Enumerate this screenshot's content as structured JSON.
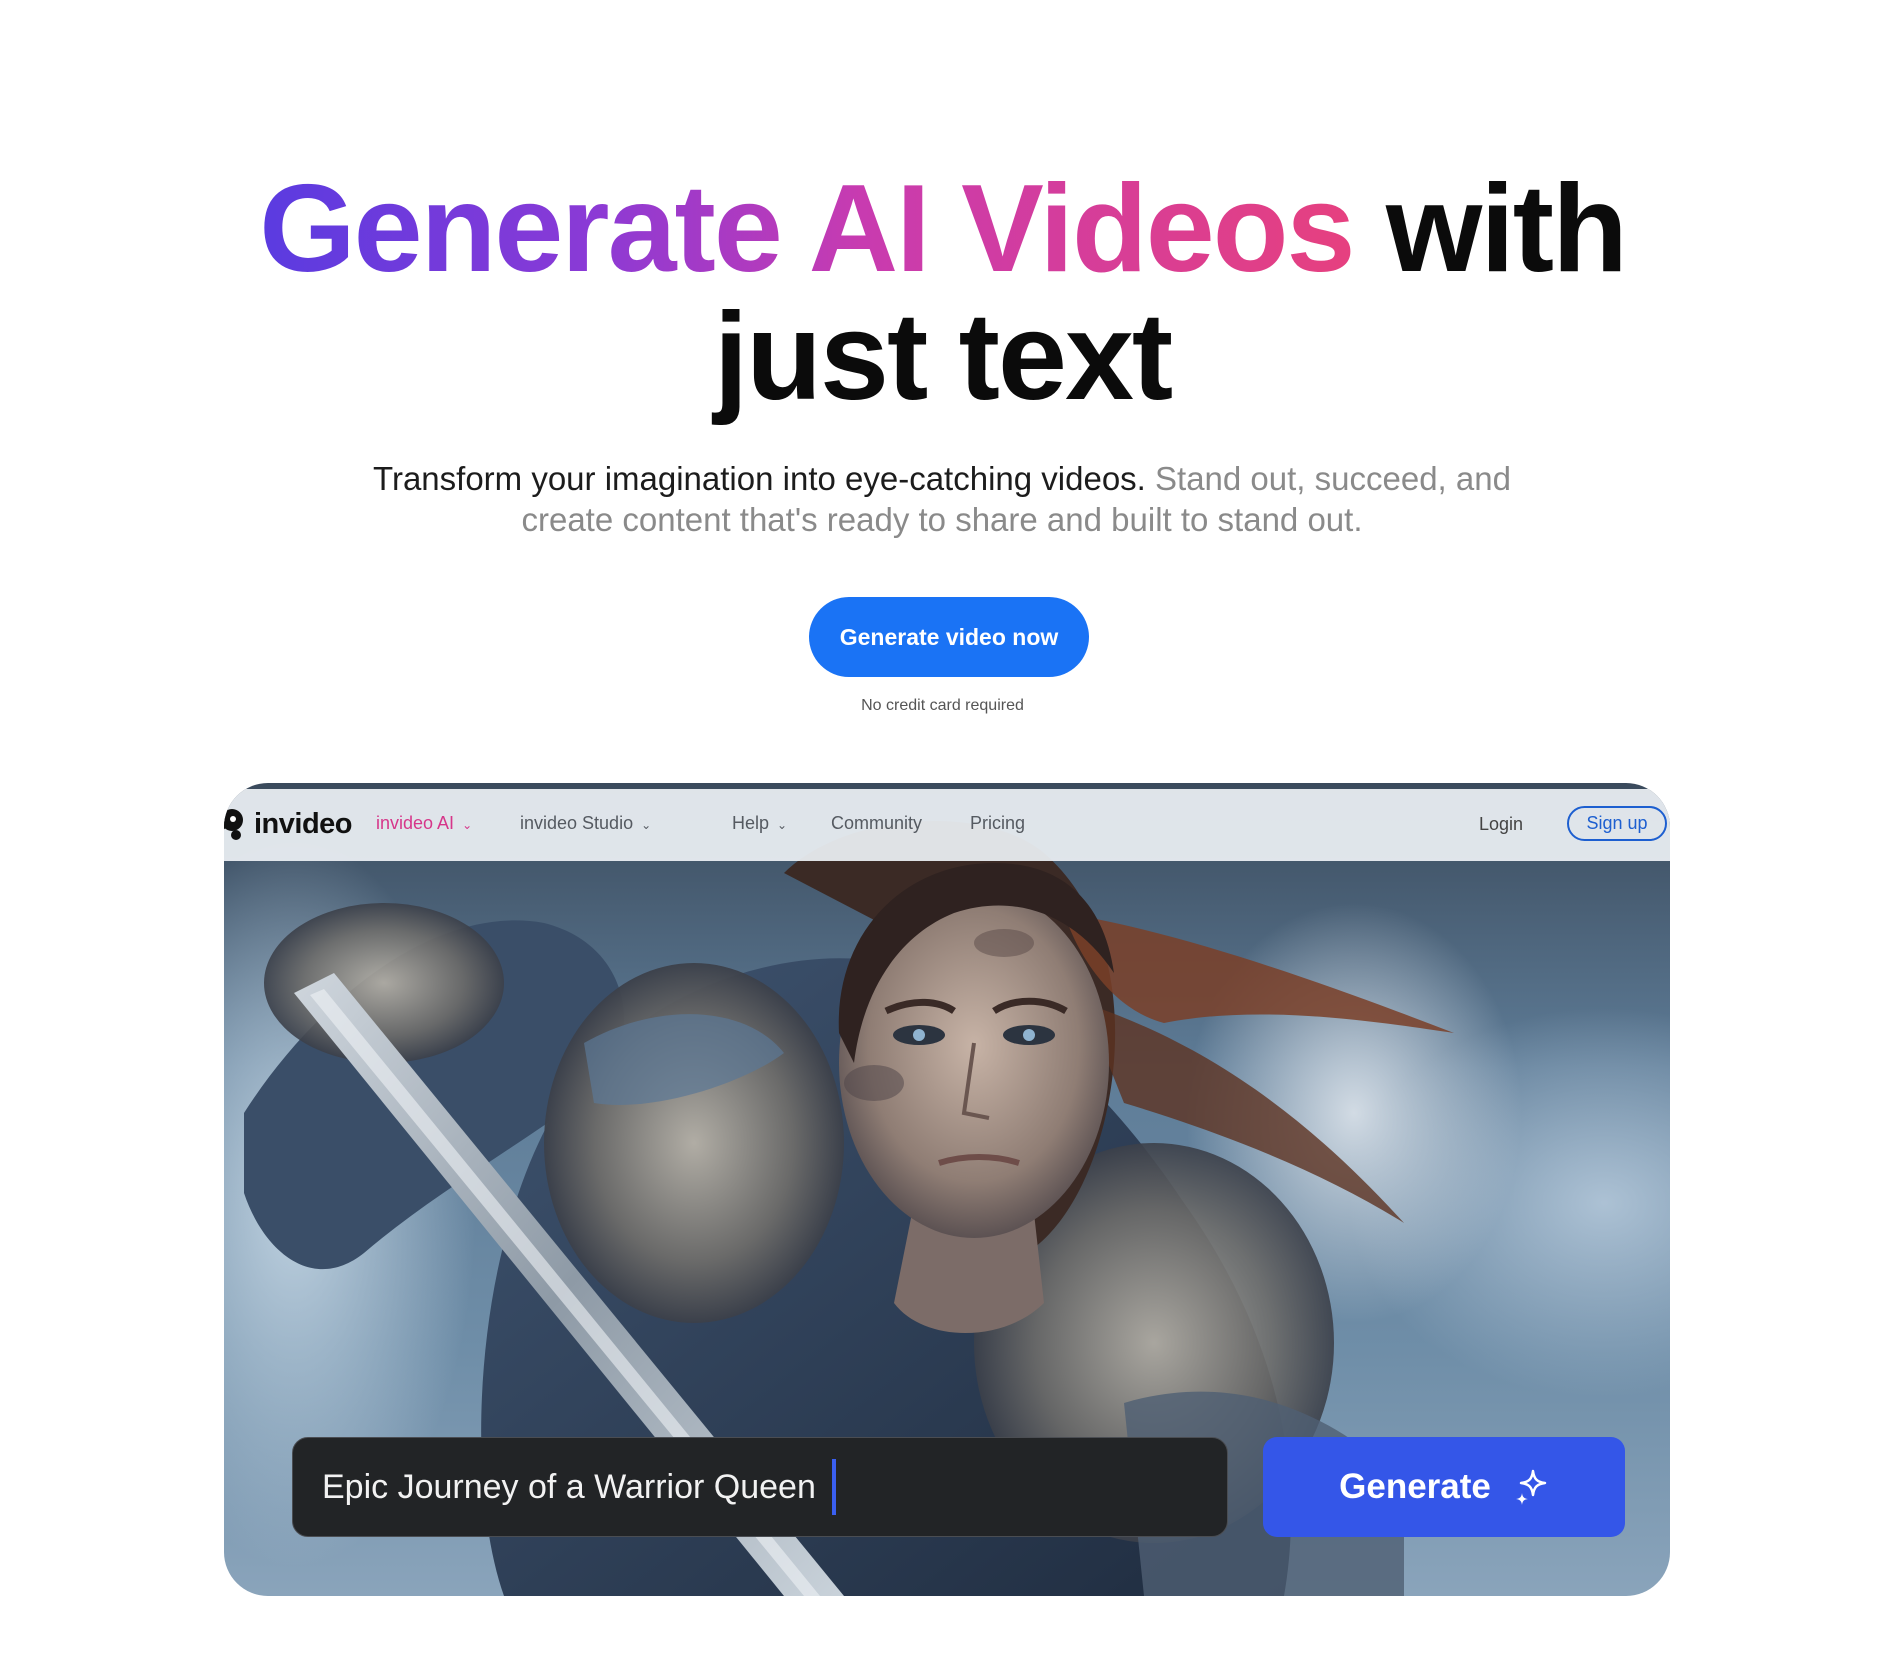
{
  "hero": {
    "title_gradient": "Generate AI Videos",
    "title_rest_line1": " with",
    "title_line2": "just text",
    "subtitle_strong": "Transform your imagination into eye-catching videos.",
    "subtitle_rest": " Stand out, succeed, and create content that's ready to share and built to stand out.",
    "cta_label": "Generate video now",
    "cta_note": "No credit card required"
  },
  "preview": {
    "nav": {
      "logo_text": "invideo",
      "items": [
        {
          "label": "invideo AI",
          "active": true,
          "dropdown": true
        },
        {
          "label": "invideo Studio",
          "active": false,
          "dropdown": true
        },
        {
          "label": "Help",
          "active": false,
          "dropdown": true
        },
        {
          "label": "Community",
          "active": false,
          "dropdown": false
        },
        {
          "label": "Pricing",
          "active": false,
          "dropdown": false
        }
      ],
      "login_label": "Login",
      "signup_label": "Sign up"
    },
    "prompt": {
      "value": "Epic Journey of a Warrior Queen"
    },
    "generate_label": "Generate",
    "icons": {
      "logo": "invideo-logo-icon",
      "dropdown": "chevron-down-icon",
      "generate": "sparkle-icon"
    }
  },
  "colors": {
    "cta": "#1a73f5",
    "generate": "#3456e8",
    "active_nav": "#d6368a",
    "signup_border": "#1d5fd0"
  }
}
